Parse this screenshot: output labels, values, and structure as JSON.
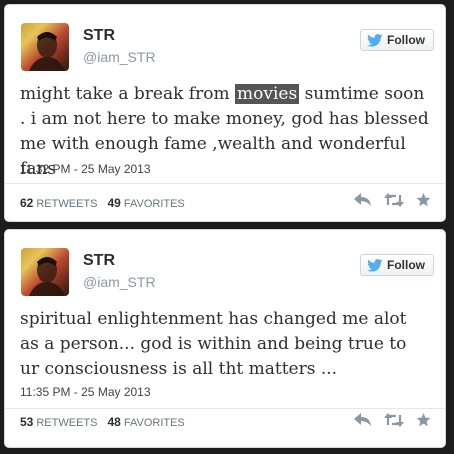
{
  "tweets": [
    {
      "name": "STR",
      "handle": "@iam_STR",
      "follow_label": "Follow",
      "text_before": "might take a break from ",
      "text_highlight": "movies",
      "text_after": " sumtime soon . i am not here to make money, god has blessed me with enough fame ,wealth and wonderful fans",
      "timestamp": "11:32 PM - 25 May 2013",
      "retweets_count": "62",
      "retweets_label": "RETWEETS",
      "favorites_count": "49",
      "favorites_label": "FAVORITES"
    },
    {
      "name": "STR",
      "handle": "@iam_STR",
      "follow_label": "Follow",
      "text": "spiritual enlightenment has changed me alot as a person... god is within and being true to ur consciousness is all tht matters ...",
      "timestamp": "11:35 PM - 25 May 2013",
      "retweets_count": "53",
      "retweets_label": "RETWEETS",
      "favorites_count": "48",
      "favorites_label": "FAVORITES"
    }
  ],
  "icons": {
    "follow": "twitter-bird-icon",
    "reply": "reply-icon",
    "retweet": "retweet-icon",
    "favorite": "star-icon"
  },
  "colors": {
    "bird": "#55acee",
    "highlight": "#555555",
    "action": "#8899a6"
  }
}
